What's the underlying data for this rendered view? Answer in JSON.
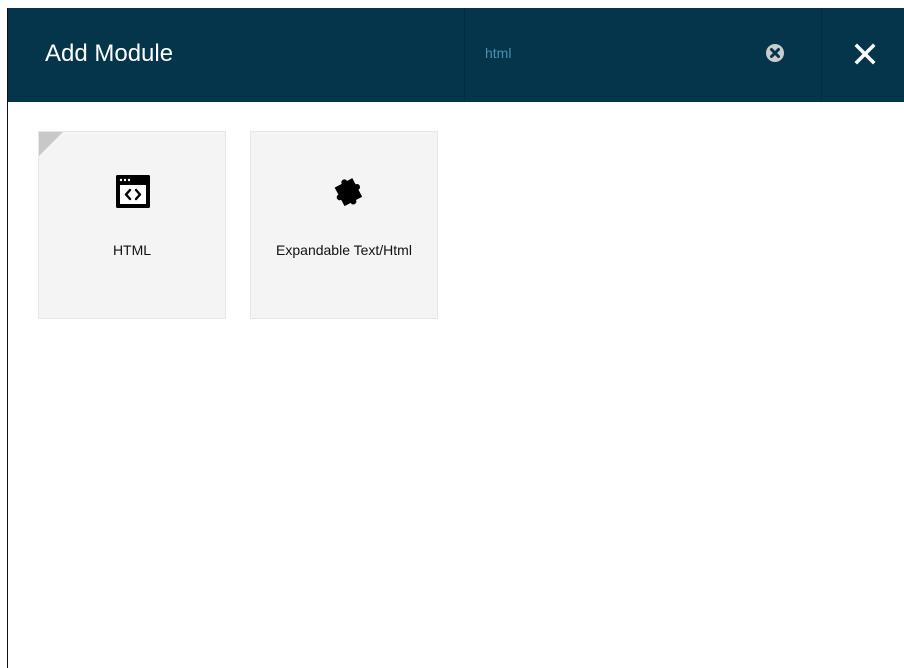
{
  "dialog": {
    "title": "Add Module",
    "search": {
      "value": "html",
      "placeholder": "html"
    },
    "clear_search_icon": "x-circle-icon",
    "close_icon": "x-icon"
  },
  "modules": [
    {
      "label": "HTML",
      "icon": "code-window-icon",
      "selected": true
    },
    {
      "label": "Expandable Text/Html",
      "icon": "puzzle-piece-icon",
      "selected": false
    }
  ],
  "colors": {
    "header": "#04354b",
    "search_text": "#4a8fb0",
    "card": "#f4f4f4",
    "selected_corner": "#c8c8c8"
  }
}
